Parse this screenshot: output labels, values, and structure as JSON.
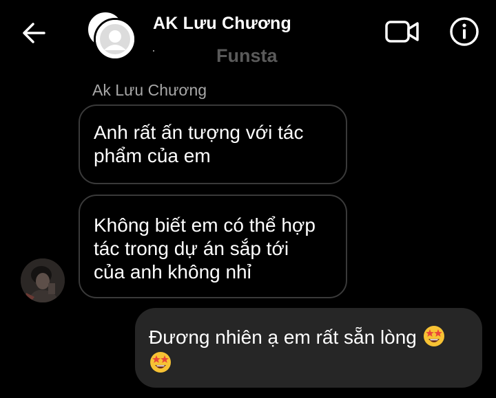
{
  "header": {
    "contact_name": "AK Lưu Chương",
    "subtitle": "Funsta"
  },
  "messages": [
    {
      "sender": "Ak Lưu Chương",
      "direction": "incoming",
      "lines": [
        "Anh rất ấn tượng với tác",
        "phẩm của em"
      ]
    },
    {
      "direction": "incoming",
      "lines": [
        "Không biết em có thể hợp",
        "tác trong dự án sắp tới",
        "của anh không nhỉ"
      ]
    },
    {
      "direction": "outgoing",
      "text": "Đương nhiên ạ em rất sẵn lòng",
      "emoji": "star-struck-emoji",
      "emoji_count": 2
    }
  ],
  "icons": {
    "back": "back-arrow-icon",
    "video": "video-call-icon",
    "info": "info-icon"
  },
  "colors": {
    "background": "#000000",
    "incoming_border": "#3a3a3a",
    "outgoing_bubble": "#262626",
    "muted_text": "#a8a8a8",
    "subtitle": "#5a5a5a"
  }
}
